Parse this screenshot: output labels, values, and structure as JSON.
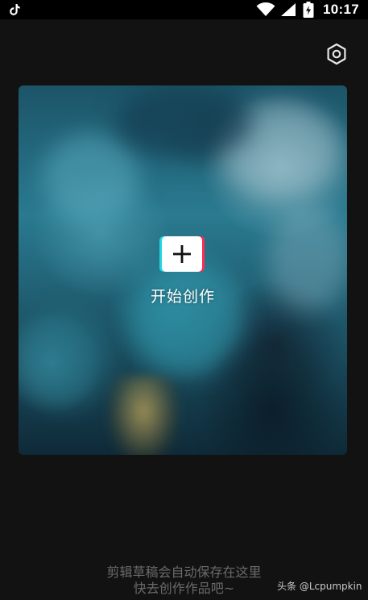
{
  "status_bar": {
    "time": "10:17",
    "icons": [
      "tiktok-icon",
      "wifi-icon",
      "signal-icon",
      "battery-icon"
    ]
  },
  "toolbar": {
    "settings_icon": "settings-icon"
  },
  "create_card": {
    "label": "开始创作",
    "plus_icon": "plus-icon"
  },
  "hint": {
    "line1": "剪辑草稿会自动保存在这里",
    "line2": "快去创作作品吧~"
  },
  "watermark": {
    "text": "头条 @Lcpumpkin"
  },
  "colors": {
    "background": "#121212",
    "hint_text": "#6a6a6a",
    "accent_cyan": "#21d6e0",
    "accent_pink": "#ff2d55"
  }
}
